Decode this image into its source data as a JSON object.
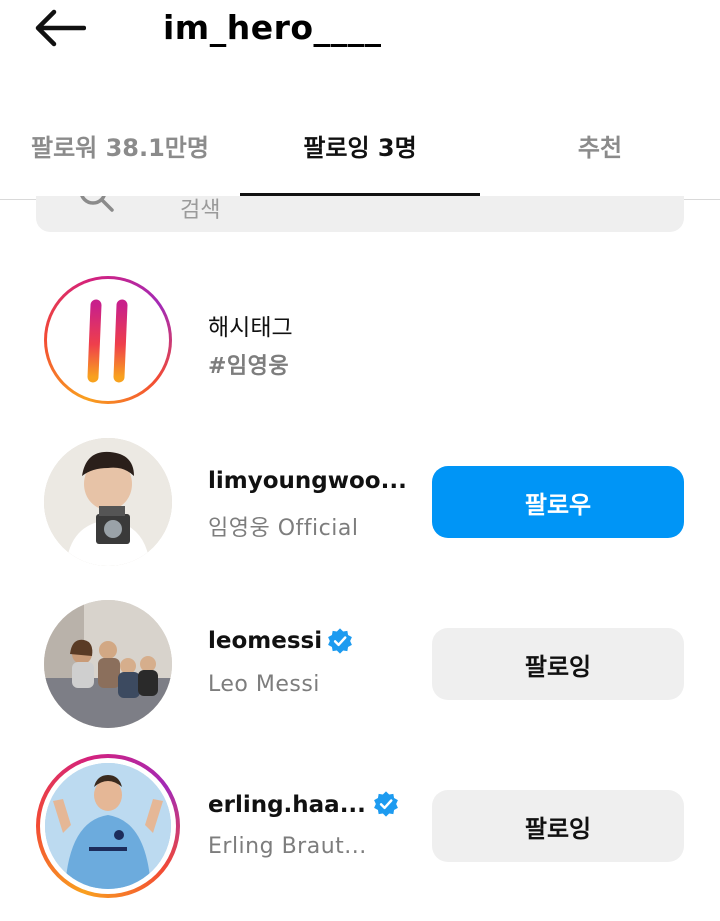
{
  "header": {
    "title": "im_hero____"
  },
  "tabs": [
    {
      "label": "팔로워 38.1만명"
    },
    {
      "label": "팔로잉 3명"
    },
    {
      "label": "추천"
    }
  ],
  "search": {
    "placeholder": "검색"
  },
  "following": [
    {
      "name": "해시태그",
      "subtitle": "#임영웅"
    },
    {
      "name": "limyoungwoo...",
      "subtitle": "임영웅 Official",
      "button": "팔로우"
    },
    {
      "name": "leomessi",
      "subtitle": "Leo Messi",
      "button": "팔로잉",
      "verified": true
    },
    {
      "name": "erling.haa...",
      "subtitle": "Erling Braut...",
      "button": "팔로잉",
      "verified": true
    }
  ],
  "colors": {
    "primary_button": "#0095f6",
    "secondary_button": "#efefef",
    "verified": "#1d9bf0"
  }
}
